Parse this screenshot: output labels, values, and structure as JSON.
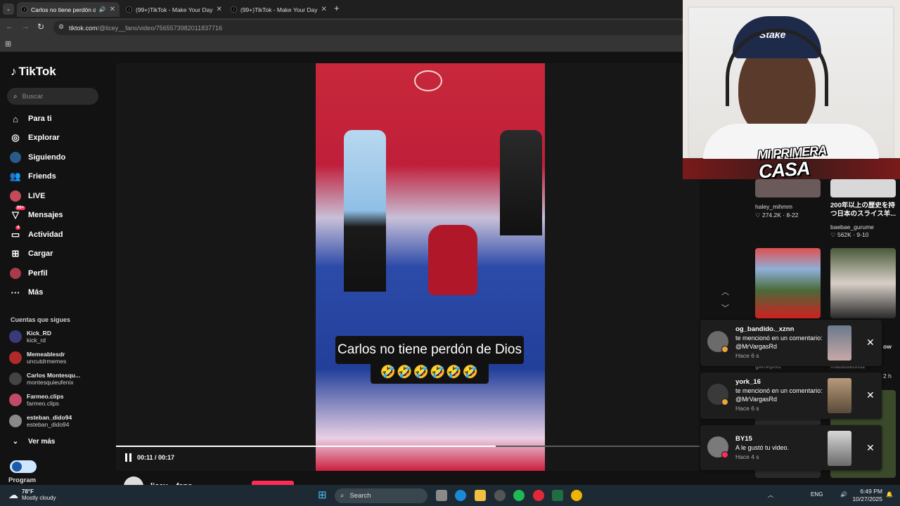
{
  "browser": {
    "tabs": [
      {
        "label": "Carlos no tiene perdón de Dios"
      },
      {
        "label": "(99+)TikTok - Make Your Day"
      },
      {
        "label": "(99+)TikTok - Make Your Day"
      }
    ],
    "url_host": "tiktok.com",
    "url_path": "/@licey__fans/video/7565573982011837716"
  },
  "sidebar": {
    "logo": "TikTok",
    "search_placeholder": "Buscar",
    "nav": [
      {
        "label": "Para ti",
        "icon": "home-icon"
      },
      {
        "label": "Explorar",
        "icon": "compass-icon"
      },
      {
        "label": "Siguiendo",
        "icon": "following-icon"
      },
      {
        "label": "Friends",
        "icon": "friends-icon"
      },
      {
        "label": "LIVE",
        "icon": "live-icon"
      },
      {
        "label": "Mensajes",
        "icon": "messages-icon",
        "badge": "99+"
      },
      {
        "label": "Actividad",
        "icon": "activity-icon",
        "badge": "4"
      },
      {
        "label": "Cargar",
        "icon": "upload-icon"
      },
      {
        "label": "Perfil",
        "icon": "profile-icon"
      },
      {
        "label": "Más",
        "icon": "more-icon"
      }
    ],
    "following_title": "Cuentas que sigues",
    "following": [
      {
        "name": "Kick_RD",
        "handle": "kick_rd",
        "color": "#3a3a7a"
      },
      {
        "name": "Memeablesdr",
        "handle": "uncutdrmemes",
        "color": "#b02a2a"
      },
      {
        "name": "Carlos Montesqu...",
        "handle": "montesquieufenix",
        "color": "#444"
      },
      {
        "name": "Farmeo.clips",
        "handle": "farmeo.clips",
        "color": "#c04a6a"
      },
      {
        "name": "esteban_dido94",
        "handle": "esteban_dido94",
        "color": "#8a8a8a"
      }
    ],
    "see_more": "Ver más",
    "program_label": "Program"
  },
  "video": {
    "caption_line1": "Carlos no tiene perdón de Dios",
    "caption_line2": "🤣🤣🤣🤣🤣🤣",
    "time": "00:11 / 00:17",
    "progress": 0.65,
    "author": "licey__fans"
  },
  "right_column": {
    "items": [
      {
        "user": "haley_mihmm",
        "stats": "♡ 274.2K · 8-22"
      },
      {
        "title": "200年以上の歴史を持つ日本のスライス羊...",
        "user": "baebae_gurume",
        "stats": "♡ 562K · 9-10"
      }
    ],
    "partial_users": [
      "gamepi92",
      "matiasalofolz"
    ],
    "partial_time": "2 h",
    "partial_word": "ow"
  },
  "notifications": [
    {
      "user": "og_bandido._xznn",
      "message": "te mencionó en un comentario: @MrVargasRd",
      "time": "Hace 6 s"
    },
    {
      "user": "york_16",
      "message": "te mencionó en un comentario: @MrVargasRd",
      "time": "Hace 6 s"
    },
    {
      "user": "BY15",
      "message": "A le gustó tu video.",
      "time": "Hace 4 s"
    }
  ],
  "overlay": {
    "title_line1": "MI PRIMERA",
    "title_line2": "CASA",
    "cap_text": "Stake"
  },
  "taskbar": {
    "weather_temp": "78°F",
    "weather_desc": "Mostly cloudy",
    "search": "Search",
    "lang": "ENG",
    "time": "6:49 PM",
    "date": "10/27/2025"
  }
}
